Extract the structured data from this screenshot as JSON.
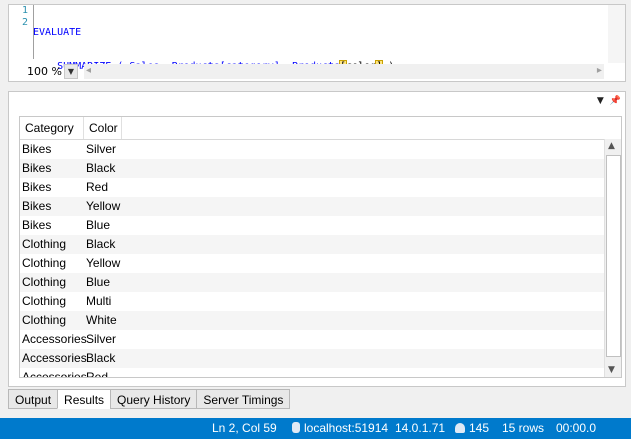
{
  "editor": {
    "lines": [
      {
        "num": "1",
        "text": "EVALUATE"
      },
      {
        "num": "2",
        "pre": "    SUMMARIZE ( Sales, Products[category], Products",
        "hl_open": "[",
        "mid": "color",
        "hl_close": "]",
        "post": " )"
      }
    ],
    "zoom": "100 %"
  },
  "results": {
    "columns": [
      "Category",
      "Color"
    ],
    "rows": [
      [
        "Bikes",
        "Silver"
      ],
      [
        "Bikes",
        "Black"
      ],
      [
        "Bikes",
        "Red"
      ],
      [
        "Bikes",
        "Yellow"
      ],
      [
        "Bikes",
        "Blue"
      ],
      [
        "Clothing",
        "Black"
      ],
      [
        "Clothing",
        "Yellow"
      ],
      [
        "Clothing",
        "Blue"
      ],
      [
        "Clothing",
        "Multi"
      ],
      [
        "Clothing",
        "White"
      ],
      [
        "Accessories",
        "Silver"
      ],
      [
        "Accessories",
        "Black"
      ],
      [
        "Accessories",
        "Red"
      ]
    ]
  },
  "tabs": [
    {
      "label": "Output",
      "active": false
    },
    {
      "label": "Results",
      "active": true
    },
    {
      "label": "Query History",
      "active": false
    },
    {
      "label": "Server Timings",
      "active": false
    }
  ],
  "status": {
    "position": "Ln 2, Col 59",
    "server": "localhost:51914",
    "version": "14.0.1.71",
    "spid": "145",
    "rows": "15 rows",
    "time": "00:00.0",
    "bg_color": "#007acc"
  }
}
